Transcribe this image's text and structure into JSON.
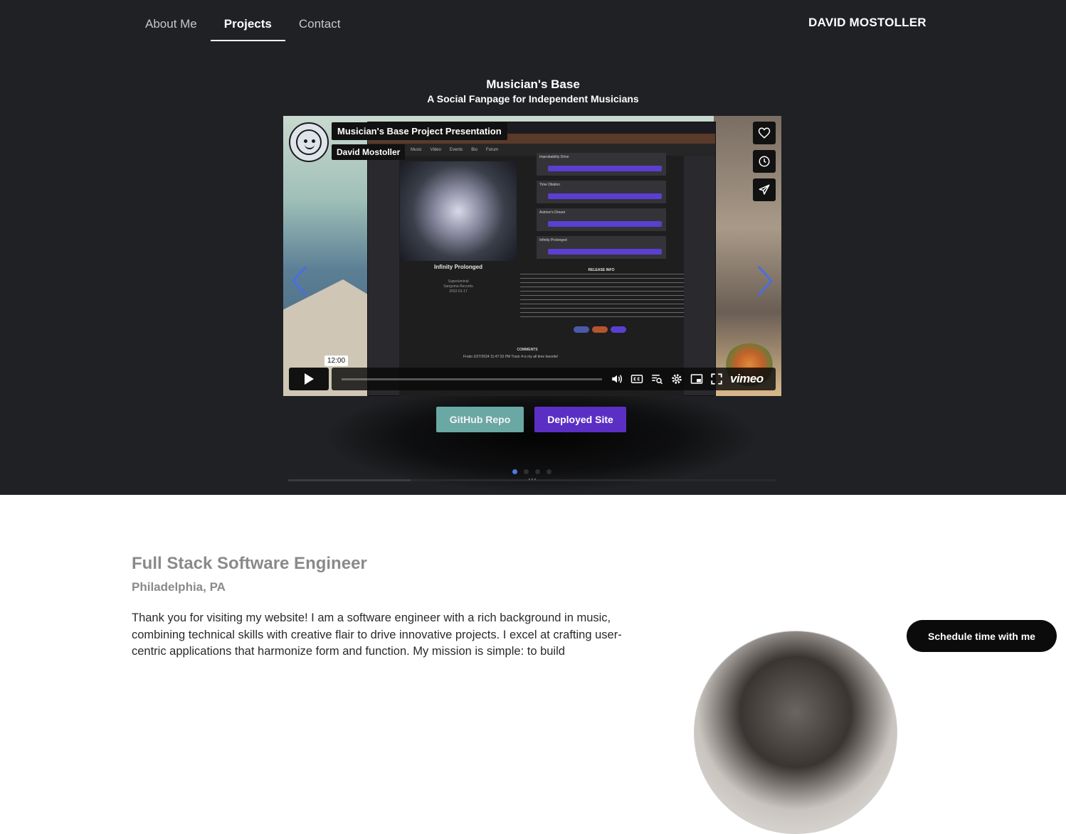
{
  "nav": {
    "items": [
      {
        "label": "About Me",
        "active": false
      },
      {
        "label": "Projects",
        "active": true
      },
      {
        "label": "Contact",
        "active": false
      }
    ],
    "brand": "DAVID MOSTOLLER"
  },
  "project": {
    "title": "Musician's Base",
    "subtitle": "A Social Fanpage for Independent Musicians",
    "video": {
      "title": "Musician's Base Project Presentation",
      "author": "David Mostoller",
      "time_tooltip": "12:00",
      "player_brand": "vimeo",
      "screen": {
        "site_nav": [
          "Music",
          "Video",
          "Events",
          "Bio",
          "Forum"
        ],
        "album_name": "Infinity Prolonged",
        "album_meta": [
          "Superluminal",
          "Sangoma Records",
          "2022-01-17"
        ],
        "tracks": [
          "Improbability Drive",
          "Time Dilation",
          "Asimov's Dream",
          "Infinity Prolonged"
        ],
        "release_heading": "RELEASE INFO",
        "comments_heading": "COMMENTS",
        "comment": "Frodo  2/27/2024 11:47:33 PM  Track 4 is my all time favorite!"
      }
    },
    "buttons": {
      "github": "GitHub Repo",
      "deployed": "Deployed Site"
    },
    "carousel": {
      "active_index": 0,
      "count": 4
    }
  },
  "about": {
    "role": "Full Stack Software Engineer",
    "location": "Philadelphia, PA",
    "bio": "Thank you for visiting my website! I am a software engineer with a rich background in music, combining technical skills with creative flair to drive innovative projects. I excel at crafting user-centric applications that harmonize form and function. My mission is simple: to build"
  },
  "schedule_button": "Schedule time with me",
  "colors": {
    "dark_bg": "#202124",
    "github_btn": "#6aa8a4",
    "deployed_btn": "#5b2fc4",
    "carousel_active": "#4a7be0"
  }
}
